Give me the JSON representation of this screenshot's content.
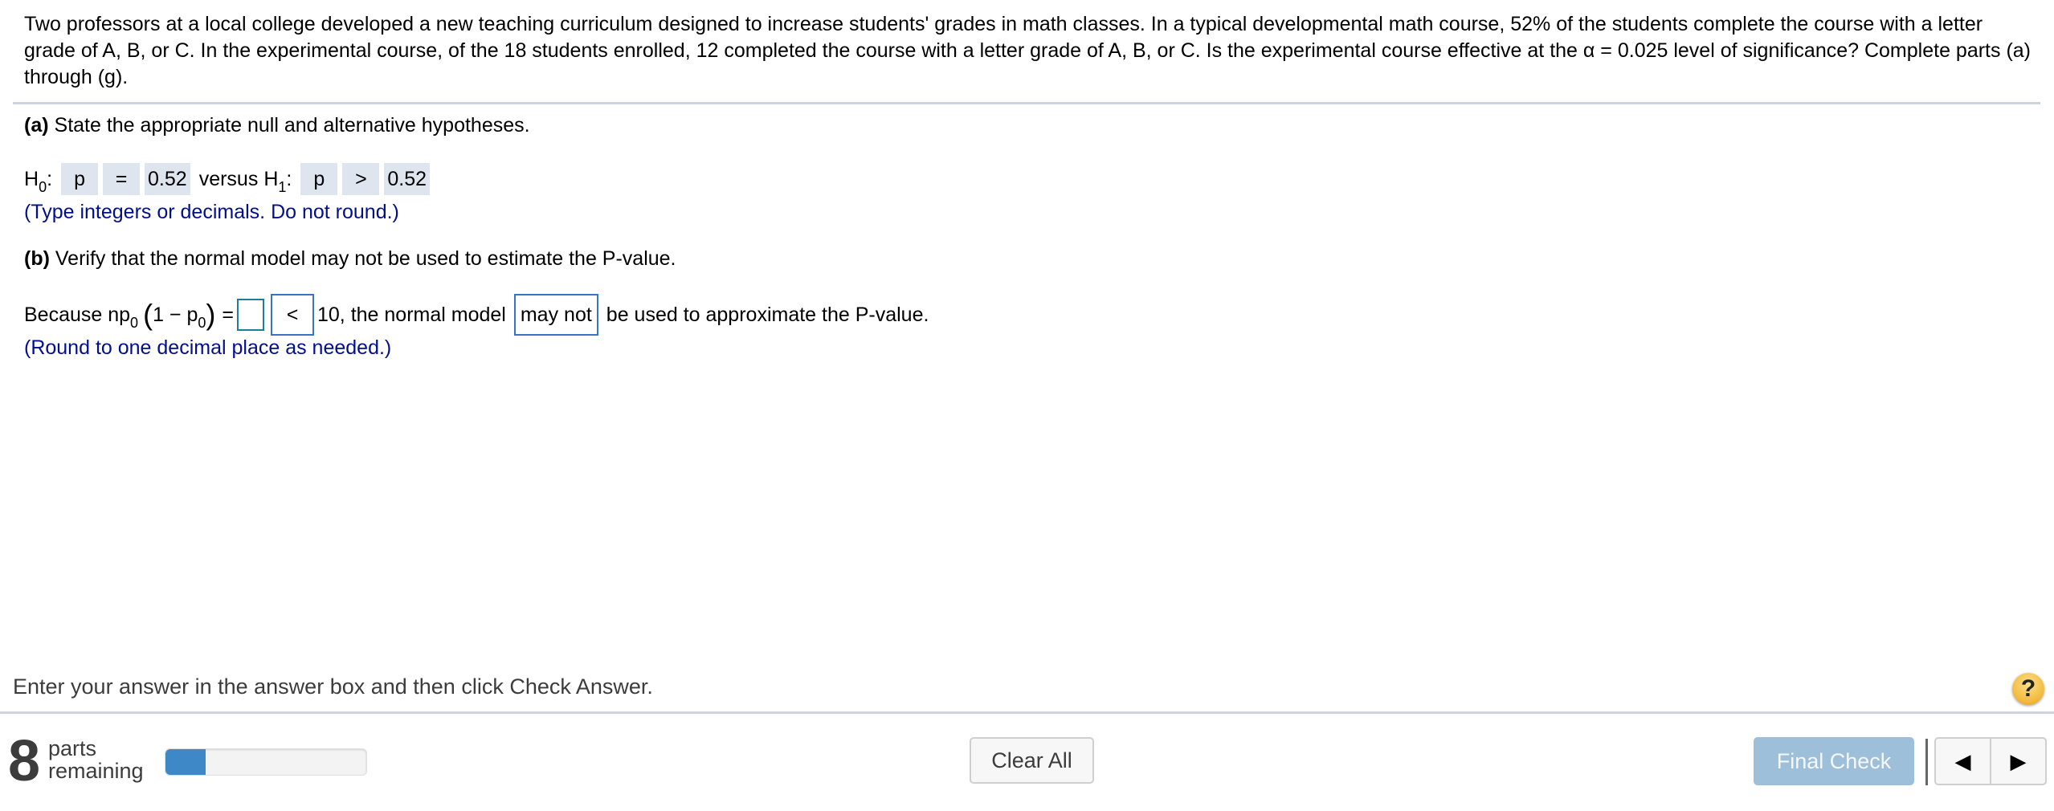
{
  "question": {
    "text": "Two professors at a local college developed a new teaching curriculum designed to increase students' grades in math classes. In a typical developmental math course, 52% of the students complete the course with a letter grade of A, B, or C. In the experimental course, of the 18 students enrolled, 12 completed the course with a letter grade of A, B, or C. Is the experimental course effective at the α = 0.025 level of significance? Complete parts (a) through (g)."
  },
  "part_a": {
    "label": "(a)",
    "prompt": "State the appropriate null and alternative hypotheses.",
    "h0_symbol": "H",
    "h0_sub": "0",
    "h0_param": "p",
    "h0_relation": "=",
    "h0_value": "0.52",
    "versus": "versus",
    "h1_symbol": "H",
    "h1_sub": "1",
    "h1_param": "p",
    "h1_relation": ">",
    "h1_value": "0.52",
    "hint": "(Type integers or decimals. Do not round.)"
  },
  "part_b": {
    "label": "(b)",
    "prompt": "Verify that the normal model may not be used to estimate the P-value.",
    "because": "Because np",
    "sub0": "0",
    "one_minus": "1 − p",
    "sub0b": "0",
    "equals": "=",
    "answer_value": "",
    "comparison": "<",
    "after_comparison": "10, the normal model",
    "model_choice": "may not",
    "tail": "be used to approximate the P-value.",
    "hint": "(Round to one decimal place as needed.)"
  },
  "footer": {
    "instruction": "Enter your answer in the answer box and then click Check Answer.",
    "help_icon": "?",
    "parts_remaining_count": "8",
    "parts_label_1": "parts",
    "parts_label_2": "remaining",
    "progress_fraction": 0.2,
    "clear_all": "Clear All",
    "final_check": "Final Check",
    "prev_icon": "◀",
    "next_icon": "▶"
  },
  "colors": {
    "hint_text": "#000e8f",
    "filled_answer_bg": "#dfe5ef",
    "progress_fill": "#3f88c8",
    "final_check_bg": "#9ebfda"
  }
}
